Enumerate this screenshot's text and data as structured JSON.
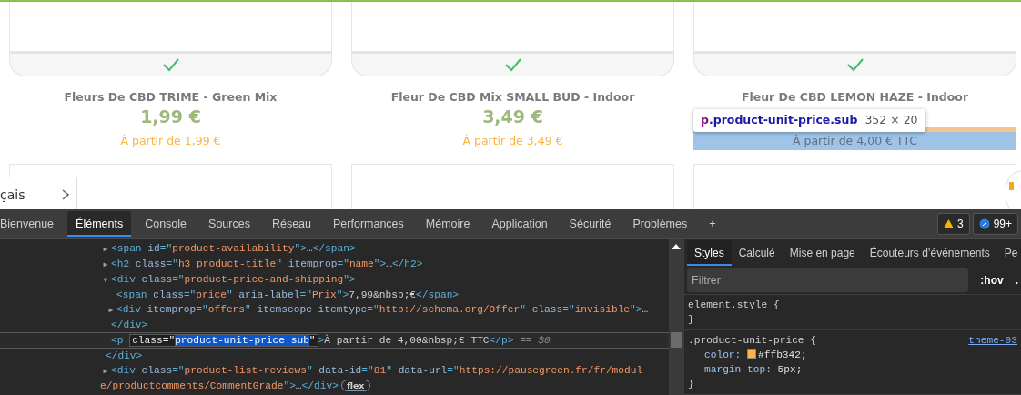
{
  "page": {
    "products": [
      {
        "title": "Fleurs De CBD TRIME - Green Mix",
        "price": "1,99 €",
        "unit_price": "À partir de 1,99 €",
        "inspected": false
      },
      {
        "title": "Fleur De CBD Mix SMALL BUD - Indoor",
        "price": "3,49 €",
        "unit_price": "À partir de 3,49 €",
        "inspected": false
      },
      {
        "title": "Fleur De CBD LEMON HAZE - Indoor",
        "unit_price": "À partir de 4,00 € TTC",
        "inspected": true
      }
    ],
    "inspect_tooltip": {
      "tag": "p",
      "selector": ".product-unit-price.sub",
      "size": "352 × 20"
    },
    "language_menu": {
      "label": "çais"
    }
  },
  "devtools": {
    "tabs": [
      {
        "label": "Bienvenue",
        "selected": false
      },
      {
        "label": "Éléments",
        "selected": true
      },
      {
        "label": "Console",
        "selected": false
      },
      {
        "label": "Sources",
        "selected": false
      },
      {
        "label": "Réseau",
        "selected": false
      },
      {
        "label": "Performances",
        "selected": false
      },
      {
        "label": "Mémoire",
        "selected": false
      },
      {
        "label": "Application",
        "selected": false
      },
      {
        "label": "Sécurité",
        "selected": false
      },
      {
        "label": "Problèmes",
        "selected": false
      }
    ],
    "add_tab": "+",
    "warnings": "3",
    "messages": "99+",
    "dom": [
      {
        "children": [
          {
            "toggle": "▶",
            "tokens": [
              {
                "kind": "tag",
                "text": "<span "
              },
              {
                "kind": "attr",
                "text": "id"
              },
              {
                "kind": "tag",
                "text": "=\""
              },
              {
                "kind": "val",
                "text": "product-availability"
              },
              {
                "kind": "tag",
                "text": "\">"
              },
              {
                "kind": "text",
                "text": "…"
              },
              {
                "kind": "tag",
                "text": "</span>"
              }
            ]
          },
          {
            "toggle": "▶",
            "tokens": [
              {
                "kind": "tag",
                "text": "<h2 "
              },
              {
                "kind": "attr",
                "text": "class"
              },
              {
                "kind": "tag",
                "text": "=\""
              },
              {
                "kind": "val",
                "text": "h3 product-title"
              },
              {
                "kind": "tag",
                "text": "\" "
              },
              {
                "kind": "attr",
                "text": "itemprop"
              },
              {
                "kind": "tag",
                "text": "=\""
              },
              {
                "kind": "val",
                "text": "name"
              },
              {
                "kind": "tag",
                "text": "\">"
              },
              {
                "kind": "text",
                "text": "…"
              },
              {
                "kind": "tag",
                "text": "</h2>"
              }
            ]
          },
          {
            "toggle": "▼",
            "tokens": [
              {
                "kind": "tag",
                "text": "<div "
              },
              {
                "kind": "attr",
                "text": "class"
              },
              {
                "kind": "tag",
                "text": "=\""
              },
              {
                "kind": "val",
                "text": "product-price-and-shipping"
              },
              {
                "kind": "tag",
                "text": "\">"
              }
            ],
            "close": "</div>",
            "children": [
              {
                "tokens": [
                  {
                    "kind": "tag",
                    "text": "<span "
                  },
                  {
                    "kind": "attr",
                    "text": "class"
                  },
                  {
                    "kind": "tag",
                    "text": "=\""
                  },
                  {
                    "kind": "val",
                    "text": "price"
                  },
                  {
                    "kind": "tag",
                    "text": "\" "
                  },
                  {
                    "kind": "attr",
                    "text": "aria-label"
                  },
                  {
                    "kind": "tag",
                    "text": "=\""
                  },
                  {
                    "kind": "val",
                    "text": "Prix"
                  },
                  {
                    "kind": "tag",
                    "text": "\">"
                  },
                  {
                    "kind": "text",
                    "text": "7,99&nbsp;€"
                  },
                  {
                    "kind": "tag",
                    "text": "</span>"
                  }
                ]
              },
              {
                "toggle": "▶",
                "tokens": [
                  {
                    "kind": "tag",
                    "text": "<div "
                  },
                  {
                    "kind": "attr",
                    "text": "itemprop"
                  },
                  {
                    "kind": "tag",
                    "text": "=\""
                  },
                  {
                    "kind": "val",
                    "text": "offers"
                  },
                  {
                    "kind": "tag",
                    "text": "\" "
                  },
                  {
                    "kind": "attr",
                    "text": "itemscope itemtype"
                  },
                  {
                    "kind": "tag",
                    "text": "=\""
                  },
                  {
                    "kind": "val",
                    "text": "http://schema.org/Offer"
                  },
                  {
                    "kind": "tag",
                    "text": "\" "
                  },
                  {
                    "kind": "attr",
                    "text": "class"
                  },
                  {
                    "kind": "tag",
                    "text": "=\""
                  },
                  {
                    "kind": "val",
                    "text": "invisible"
                  },
                  {
                    "kind": "tag",
                    "text": "\">"
                  },
                  {
                    "kind": "text",
                    "text": "…"
                  }
                ]
              }
            ]
          },
          {
            "selected": true,
            "tokens": [
              {
                "kind": "tag",
                "text": "<p "
              },
              {
                "kind": "edit",
                "text": "class=\""
              },
              {
                "kind": "selection",
                "text": "product-unit-price sub"
              },
              {
                "kind": "edit",
                "text": "\""
              },
              {
                "kind": "tag",
                "text": ">"
              },
              {
                "kind": "text",
                "text": "À partir de 4,00&nbsp;€ TTC"
              },
              {
                "kind": "tag",
                "text": "</p>"
              },
              {
                "kind": "dim",
                "text": " == $0"
              }
            ]
          }
        ],
        "close": "</div>"
      },
      {
        "toggle": "▶",
        "tokens": [
          {
            "kind": "tag",
            "text": "<div "
          },
          {
            "kind": "attr",
            "text": "class"
          },
          {
            "kind": "tag",
            "text": "=\""
          },
          {
            "kind": "val",
            "text": "product-list-reviews"
          },
          {
            "kind": "tag",
            "text": "\" "
          },
          {
            "kind": "attr",
            "text": "data-id"
          },
          {
            "kind": "tag",
            "text": "=\""
          },
          {
            "kind": "val",
            "text": "81"
          },
          {
            "kind": "tag",
            "text": "\" "
          },
          {
            "kind": "attr",
            "text": "data-url"
          },
          {
            "kind": "tag",
            "text": "=\""
          },
          {
            "kind": "val",
            "text": "https://pausegreen.fr/fr/module/productcomments/CommentGrade"
          },
          {
            "kind": "tag",
            "text": "\">"
          },
          {
            "kind": "text",
            "text": "…"
          },
          {
            "kind": "tag",
            "text": "</div>"
          },
          {
            "kind": "badge",
            "text": "flex"
          }
        ]
      }
    ],
    "side_tabs": [
      {
        "label": "Styles",
        "selected": true
      },
      {
        "label": "Calculé",
        "selected": false
      },
      {
        "label": "Mise en page",
        "selected": false
      },
      {
        "label": "Écouteurs d’événements",
        "selected": false
      },
      {
        "label": "Pe",
        "selected": false
      }
    ],
    "filter": {
      "placeholder": "Filtrer"
    },
    "filter_buttons": [
      ":hov",
      "."
    ],
    "rules": [
      {
        "selector": "element.style {",
        "close": "}"
      },
      {
        "selector": ".product-unit-price {",
        "source": "theme-03",
        "declarations": [
          {
            "property": "color:",
            "value": "#ffb342;",
            "color": "#ffb342"
          },
          {
            "property": "margin-top:",
            "value": "5px;"
          }
        ],
        "close": "}"
      }
    ]
  }
}
